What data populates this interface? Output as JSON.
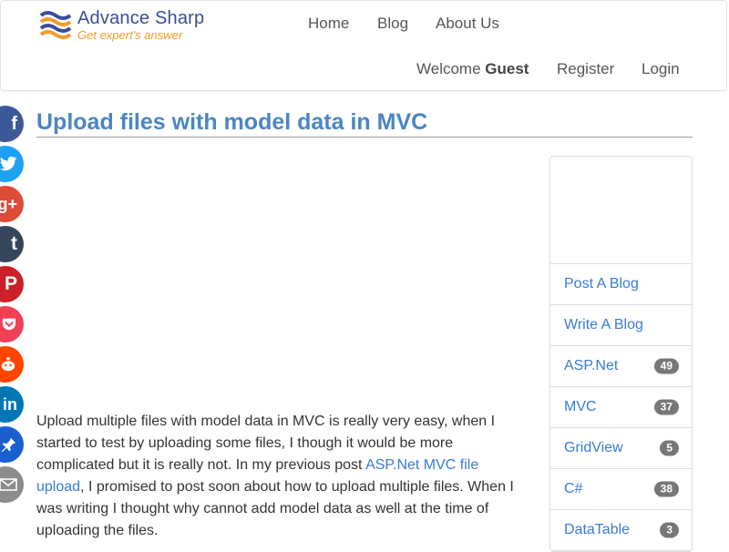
{
  "brand": {
    "name": "Advance Sharp",
    "tagline": "Get expert's answer"
  },
  "nav": {
    "home": "Home",
    "blog": "Blog",
    "about": "About Us",
    "welcome_prefix": "Welcome",
    "welcome_user": "Guest",
    "register": "Register",
    "login": "Login"
  },
  "share_icons": [
    "facebook-icon",
    "twitter-icon",
    "google-plus-icon",
    "tumblr-icon",
    "pinterest-icon",
    "pocket-icon",
    "reddit-icon",
    "linkedin-icon",
    "pin-icon",
    "email-icon"
  ],
  "article": {
    "title": "Upload files with model data in MVC",
    "body_part1": "Upload multiple files with model data in MVC is really very easy, when I started to test by uploading some files, I though it would be more complicated but it is really not. In my previous post ",
    "link_text": "ASP.Net MVC file upload",
    "body_part2": ", I promised to post soon about how to upload multiple files. When I was writing I thought why cannot add model data as well at the time of uploading the files."
  },
  "sidebar": {
    "items": [
      {
        "label": "Post A Blog",
        "count": ""
      },
      {
        "label": "Write A Blog",
        "count": ""
      },
      {
        "label": "ASP.Net",
        "count": "49"
      },
      {
        "label": "MVC",
        "count": "37"
      },
      {
        "label": "GridView",
        "count": "5"
      },
      {
        "label": "C#",
        "count": "38"
      },
      {
        "label": "DataTable",
        "count": "3"
      }
    ]
  },
  "colors": {
    "facebook": "#3b5998",
    "twitter": "#1da1f2",
    "google_plus": "#dd4b39",
    "tumblr": "#35465c",
    "pinterest": "#cb2027",
    "pocket": "#ef4056",
    "reddit": "#ff4500",
    "linkedin": "#0077b5",
    "pin": "#1a5fd0",
    "email": "#8c8c8c",
    "title": "#4a86c2",
    "link": "#3a7bd5"
  }
}
